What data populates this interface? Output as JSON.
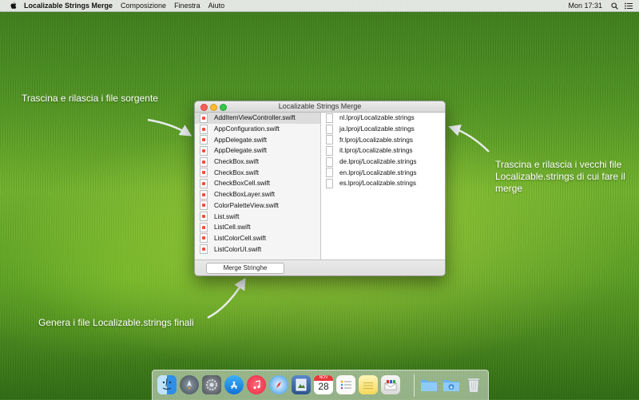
{
  "menubar": {
    "app_name": "Localizable Strings Merge",
    "menus": [
      "Composizione",
      "Finestra",
      "Aiuto"
    ],
    "clock": "Mon 17:31"
  },
  "annotations": {
    "source": "Trascina e rilascia i file sorgente",
    "old_files_1": "Trascina e rilascia i vecchi file",
    "old_files_2": "Localizable.strings di cui fare il",
    "old_files_3": "merge",
    "generate": "Genera i file Localizable.strings finali"
  },
  "window": {
    "title": "Localizable Strings Merge",
    "source_files": [
      "AddItemViewController.swift",
      "AppConfiguration.swift",
      "AppDelegate.swift",
      "AppDelegate.swift",
      "CheckBox.swift",
      "CheckBox.swift",
      "CheckBoxCell.swift",
      "CheckBoxLayer.swift",
      "ColorPaletteView.swift",
      "List.swift",
      "ListCell.swift",
      "ListColorCell.swift",
      "ListColorUI.swift"
    ],
    "strings_files": [
      "nl.lproj/Localizable.strings",
      "ja.lproj/Localizable.strings",
      "fr.lproj/Localizable.strings",
      "it.lproj/Localizable.strings",
      "de.lproj/Localizable.strings",
      "en.lproj/Localizable.strings",
      "es.lproj/Localizable.strings"
    ],
    "merge_button": "Merge Stringhe"
  },
  "dock": {
    "calendar_month": "NOV",
    "calendar_day": "28",
    "icons": [
      "finder-icon",
      "launchpad-icon",
      "system-preferences-icon",
      "app-store-icon",
      "itunes-icon",
      "safari-icon",
      "preview-icon",
      "calendar-icon",
      "reminders-icon",
      "notes-icon",
      "mail-icon",
      "folder-icon",
      "downloads-icon",
      "trash-icon"
    ]
  }
}
